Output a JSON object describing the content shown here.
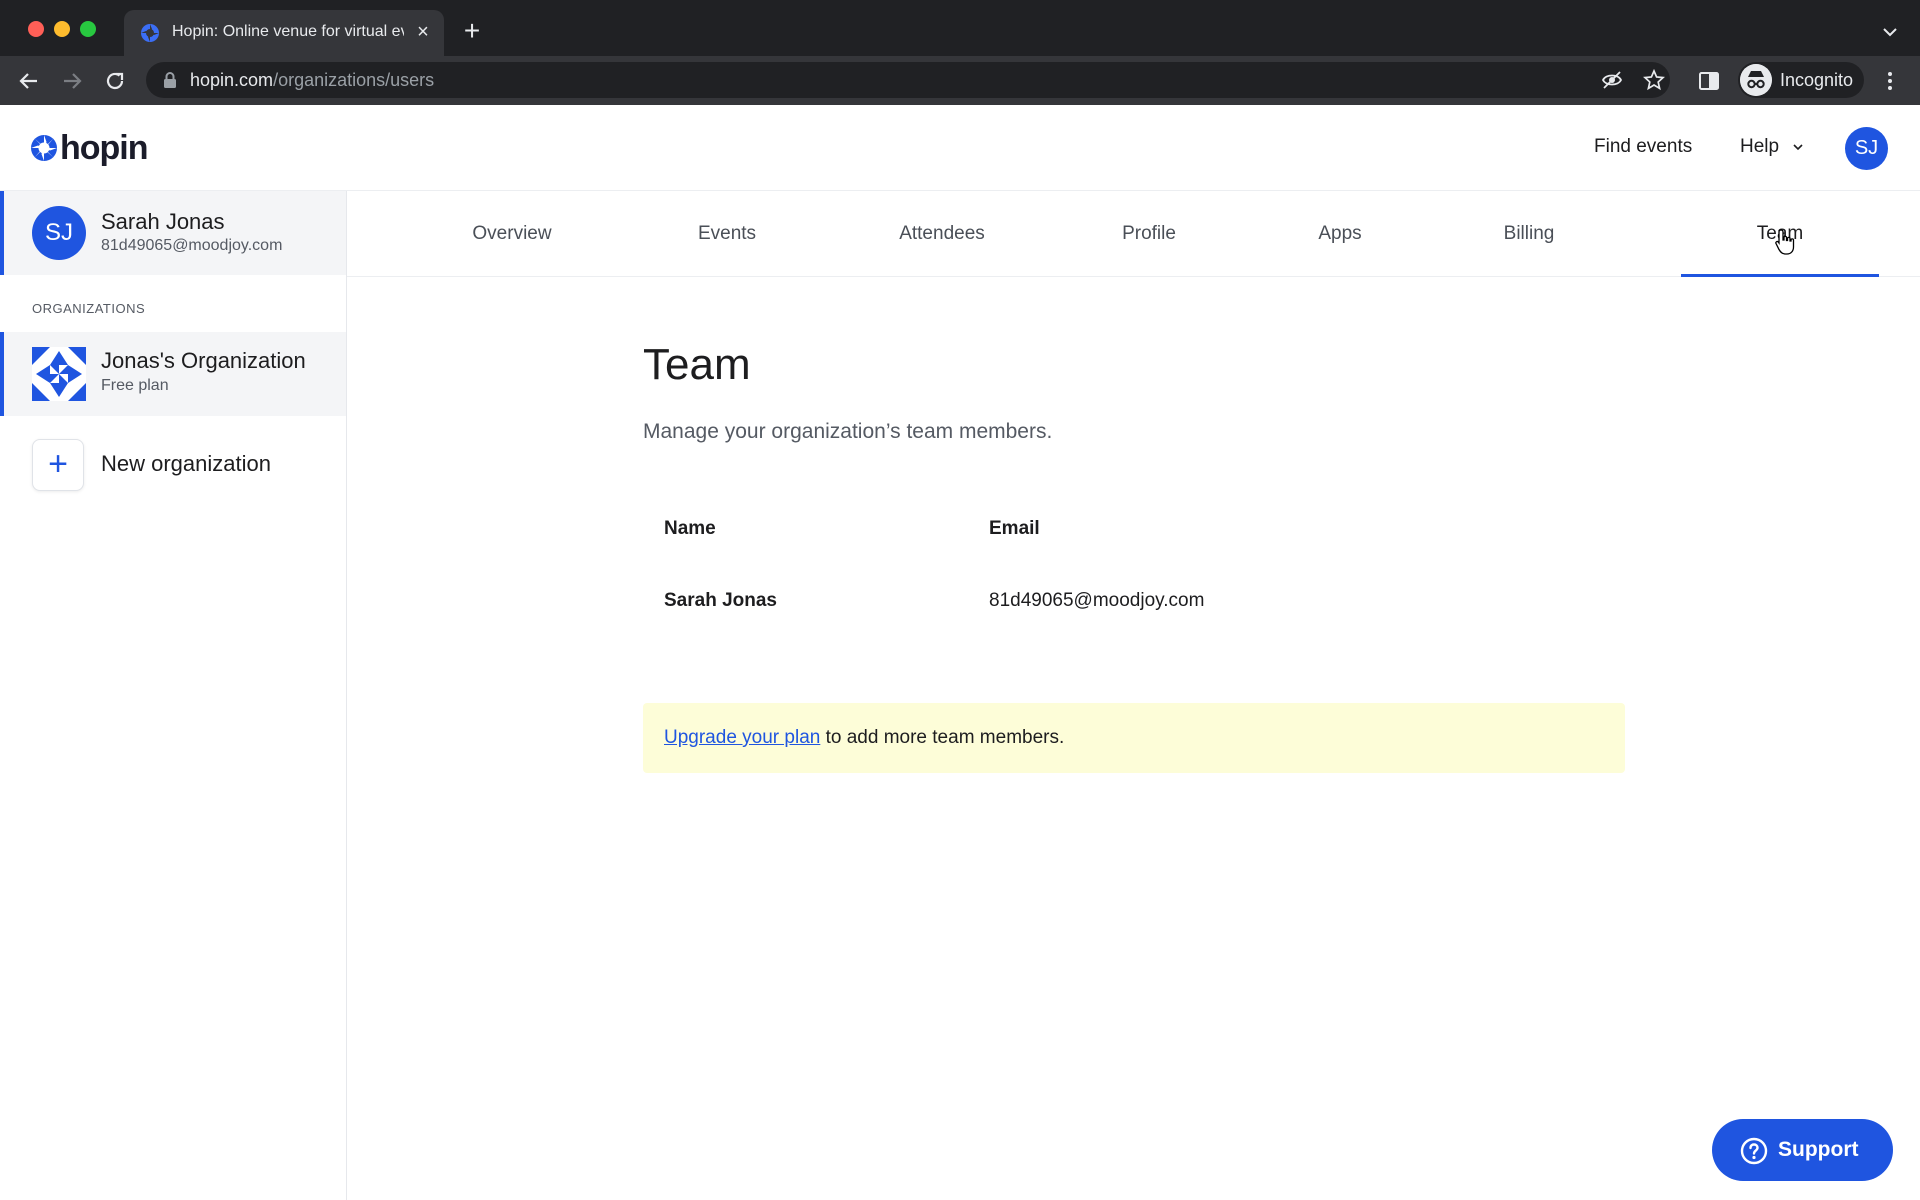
{
  "browser": {
    "tab_title": "Hopin: Online venue for virtual events",
    "url_domain": "hopin.com",
    "url_path": "/organizations/users",
    "profile_label": "Incognito"
  },
  "header": {
    "logo_text": "hopin",
    "find_events": "Find events",
    "help": "Help",
    "avatar_initials": "SJ"
  },
  "sidebar": {
    "user": {
      "initials": "SJ",
      "name": "Sarah Jonas",
      "email": "81d49065@moodjoy.com"
    },
    "organizations_label": "ORGANIZATIONS",
    "organization": {
      "name": "Jonas's Organization",
      "plan": "Free plan"
    },
    "new_organization": "New organization"
  },
  "tabs": [
    {
      "label": "Overview"
    },
    {
      "label": "Events"
    },
    {
      "label": "Attendees"
    },
    {
      "label": "Profile"
    },
    {
      "label": "Apps"
    },
    {
      "label": "Billing"
    },
    {
      "label": "Team"
    }
  ],
  "active_tab": "Team",
  "main": {
    "title": "Team",
    "subtitle": "Manage your organization’s team members.",
    "table": {
      "columns": [
        "Name",
        "Email"
      ],
      "rows": [
        {
          "name": "Sarah Jonas",
          "email": "81d49065@moodjoy.com"
        }
      ]
    },
    "notice": {
      "link_text": "Upgrade your plan",
      "text": " to add more team members."
    }
  },
  "support_label": "Support",
  "colors": {
    "brand": "#1f55e0",
    "notice_bg": "#fdfdd8",
    "chrome_bg": "#202124"
  }
}
